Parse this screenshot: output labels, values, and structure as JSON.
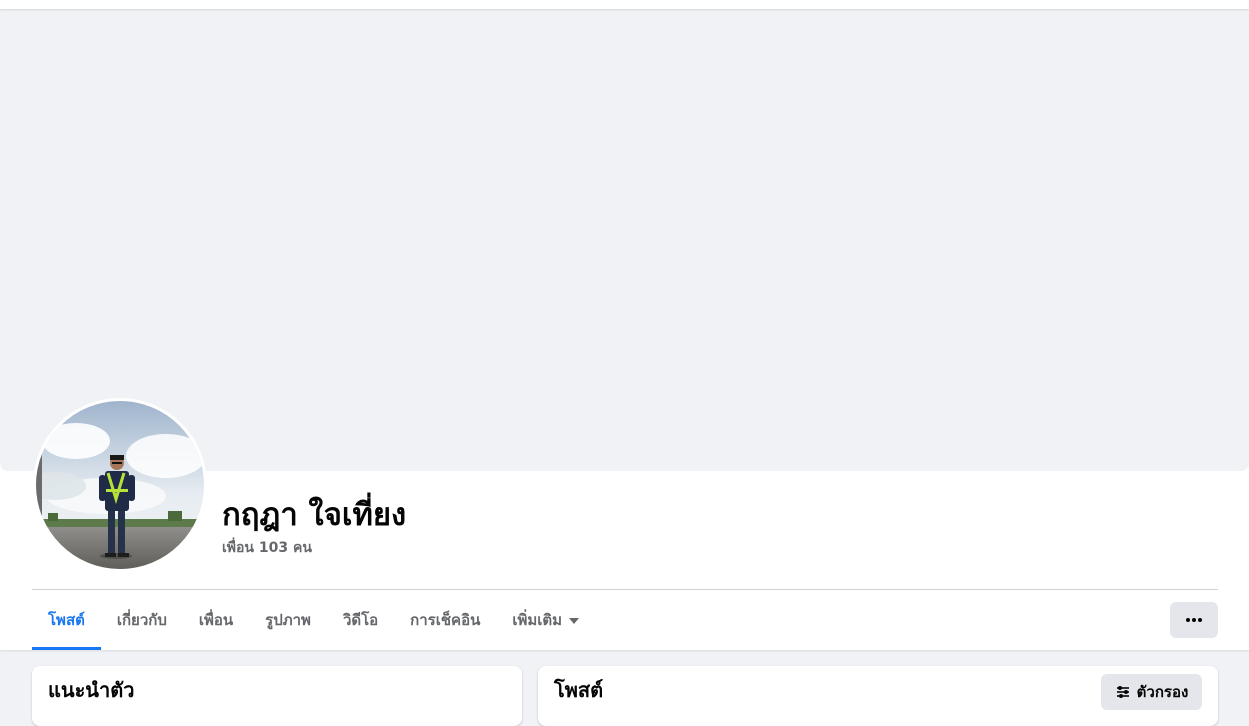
{
  "profile": {
    "name": "กฤฎา ใจเที่ยง",
    "friends_count": "เพื่อน 103 คน"
  },
  "tabs": [
    {
      "label": "โพสต์",
      "active": true
    },
    {
      "label": "เกี่ยวกับ",
      "active": false
    },
    {
      "label": "เพื่อน",
      "active": false
    },
    {
      "label": "รูปภาพ",
      "active": false
    },
    {
      "label": "วิดีโอ",
      "active": false
    },
    {
      "label": "การเช็คอิน",
      "active": false
    },
    {
      "label": "เพิ่มเติม",
      "active": false
    }
  ],
  "more_options_icon": "ellipsis-icon",
  "intro": {
    "title": "แนะนำตัว"
  },
  "posts": {
    "title": "โพสต์",
    "filter_label": "ตัวกรอง",
    "filter_icon": "sliders-icon"
  },
  "colors": {
    "accent": "#1877f2",
    "background": "#f0f2f5",
    "secondary_text": "#65676b",
    "button_bg": "#e4e6eb"
  }
}
